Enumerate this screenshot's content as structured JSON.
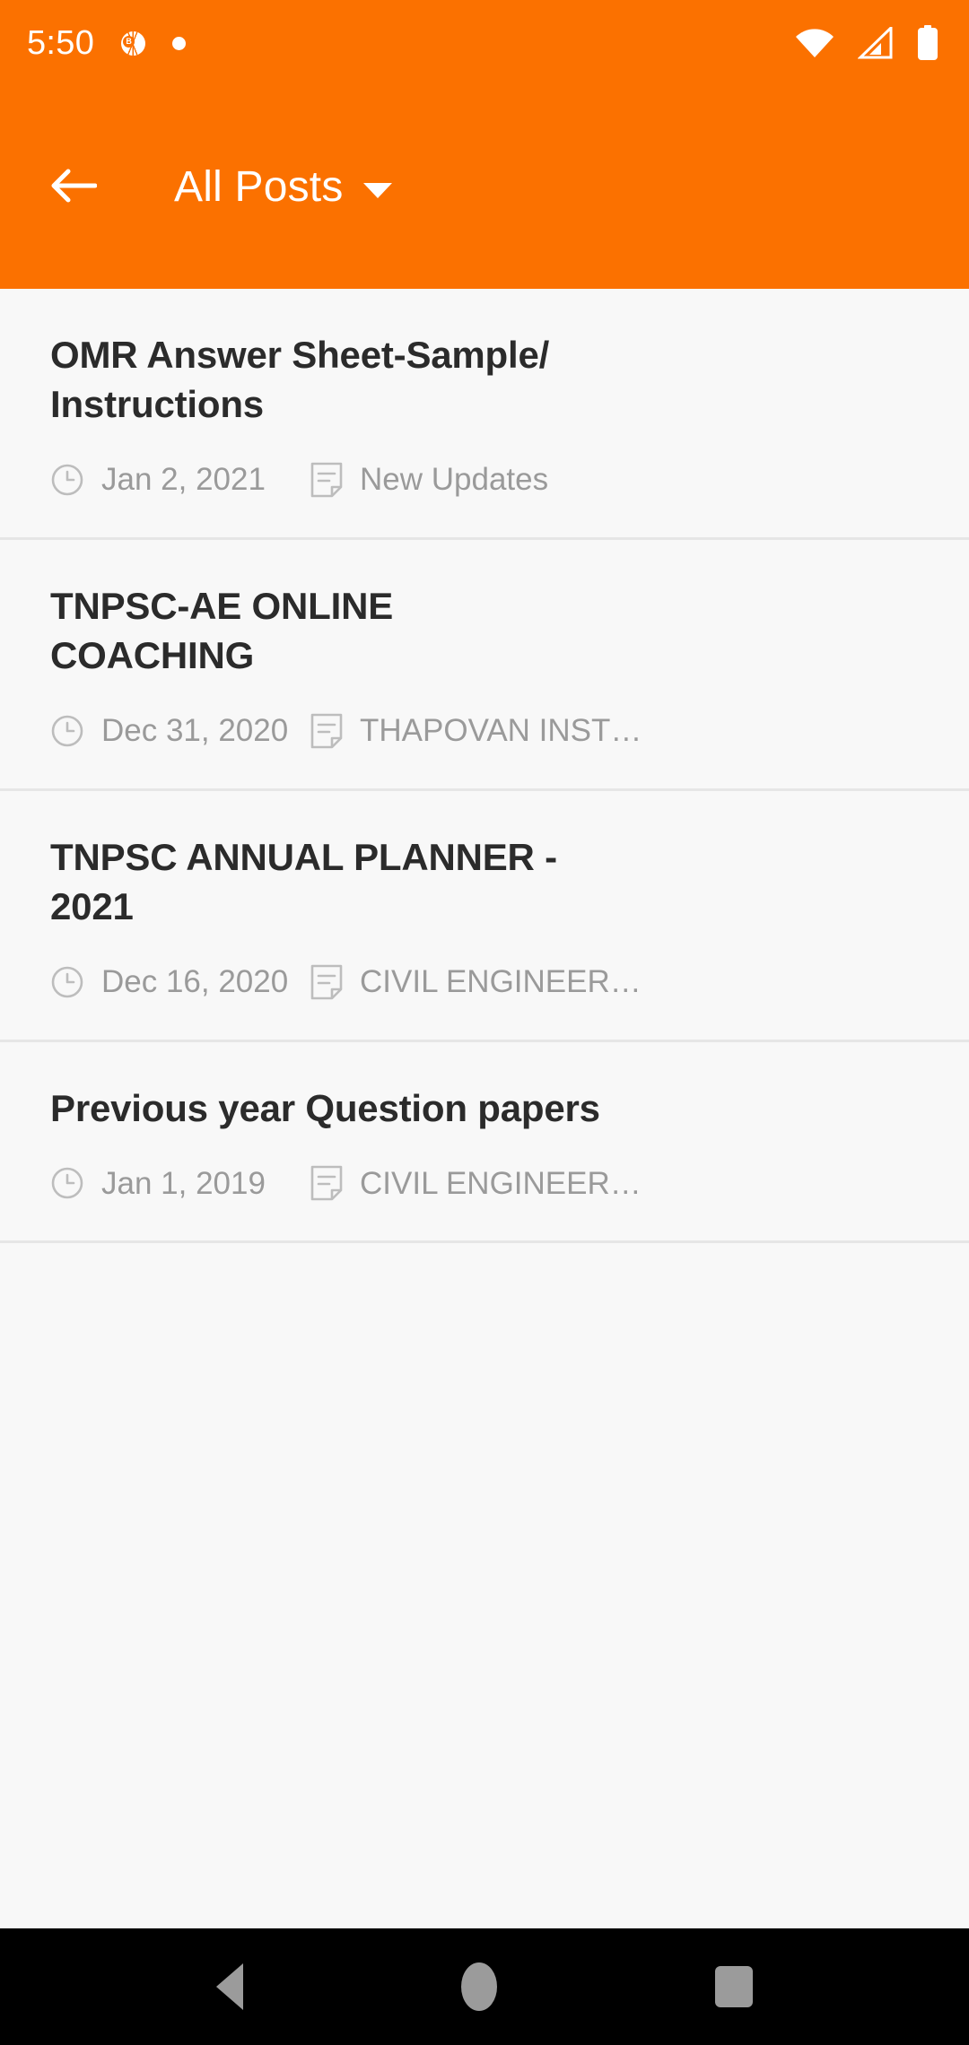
{
  "theme": {
    "accent": "#FB7100",
    "page_background": "#F8F8F8",
    "title_color": "#2B2B2B",
    "meta_color": "#9A9A9A",
    "divider_color": "#E6E6E6",
    "navbar_background": "#000000",
    "navbar_icon_color": "#9B9B9B"
  },
  "status_bar": {
    "time": "5:50",
    "app_badge_letter": "B",
    "icons": [
      "basketball-app-icon",
      "notification-dot",
      "wifi-icon",
      "cellular-signal-icon",
      "battery-icon"
    ]
  },
  "app_bar": {
    "back_icon": "arrow-left-icon",
    "title": "All Posts",
    "dropdown_icon": "caret-down-icon"
  },
  "posts": [
    {
      "title": "OMR Answer Sheet-Sample/ Instructions",
      "date": "Jan 2, 2021",
      "category": "New Updates",
      "date_icon": "clock-icon",
      "category_icon": "note-icon"
    },
    {
      "title": "TNPSC-AE ONLINE COACHING",
      "date": "Dec 31, 2020",
      "category": "THAPOVAN INST…",
      "date_icon": "clock-icon",
      "category_icon": "note-icon"
    },
    {
      "title": "TNPSC ANNUAL PLANNER - 2021",
      "date": "Dec 16, 2020",
      "category": "CIVIL ENGINEER…",
      "date_icon": "clock-icon",
      "category_icon": "note-icon"
    },
    {
      "title": "Previous year Question papers",
      "date": "Jan 1, 2019",
      "category": "CIVIL ENGINEER…",
      "date_icon": "clock-icon",
      "category_icon": "note-icon"
    }
  ],
  "nav_bar": {
    "back_label": "Back",
    "home_label": "Home",
    "recents_label": "Recents"
  }
}
